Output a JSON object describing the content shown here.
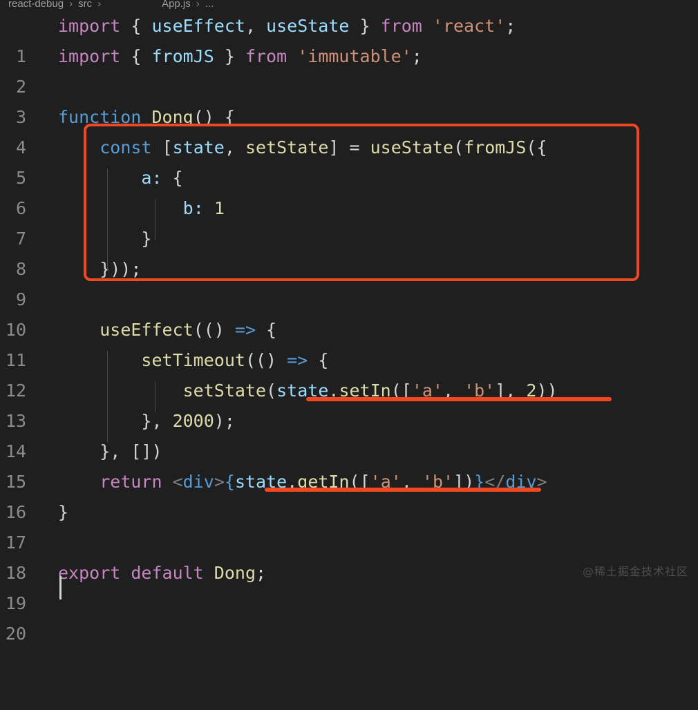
{
  "window": {
    "background_color": "#1f1f1f",
    "kind": "code-editor"
  },
  "breadcrumb": {
    "segments": [
      "react-debug",
      "src",
      "App.js",
      "..."
    ],
    "separator": "›",
    "full_text": "react-debug › src › App.js › ..."
  },
  "gutter": {
    "line_numbers": [
      "1",
      "2",
      "3",
      "4",
      "5",
      "6",
      "7",
      "8",
      "9",
      "10",
      "11",
      "12",
      "13",
      "14",
      "15",
      "16",
      "17",
      "18",
      "19",
      "20"
    ]
  },
  "editor": {
    "language": "javascript",
    "filename": "App.js",
    "lines": [
      {
        "n": "1",
        "text": "import { useEffect, useState } from 'react';"
      },
      {
        "n": "2",
        "text": "import { fromJS } from 'immutable';"
      },
      {
        "n": "3",
        "text": ""
      },
      {
        "n": "4",
        "text": "function Dong() {"
      },
      {
        "n": "5",
        "text": "    const [state, setState] = useState(fromJS({"
      },
      {
        "n": "6",
        "text": "        a: {"
      },
      {
        "n": "7",
        "text": "            b: 1"
      },
      {
        "n": "8",
        "text": "        }"
      },
      {
        "n": "9",
        "text": "    }));"
      },
      {
        "n": "10",
        "text": ""
      },
      {
        "n": "11",
        "text": "    useEffect(() => {"
      },
      {
        "n": "12",
        "text": "        setTimeout(() => {"
      },
      {
        "n": "13",
        "text": "            setState(state.setIn(['a', 'b'], 2))"
      },
      {
        "n": "14",
        "text": "        }, 2000);"
      },
      {
        "n": "15",
        "text": "    }, [])"
      },
      {
        "n": "16",
        "text": "    return <div>{state.getIn(['a', 'b'])}</div>"
      },
      {
        "n": "17",
        "text": "}"
      },
      {
        "n": "18",
        "text": ""
      },
      {
        "n": "19",
        "text": "export default Dong;"
      },
      {
        "n": "20",
        "text": ""
      }
    ]
  },
  "annotations": {
    "highlight_box": {
      "label": "red-rectangle-around-usestate-block",
      "covers_lines": [
        "5",
        "6",
        "7",
        "8",
        "9"
      ],
      "color": "#f24822"
    },
    "underlines": [
      {
        "label": "red-underline-setIn-call",
        "on_line": "13",
        "text": "state.setIn(['a', 'b'], 2)",
        "color": "#f24822"
      },
      {
        "label": "red-underline-getIn-call",
        "on_line": "16",
        "text": "state.getIn(['a', 'b'])",
        "color": "#f24822"
      }
    ]
  },
  "caret": {
    "on_line": "20",
    "column": "1"
  },
  "watermark": {
    "text": "@稀土掘金技术社区"
  },
  "theme": {
    "background": "#1f1f1f",
    "line_number": "#8b8b8b",
    "keyword": "#c586c0",
    "keyword_control": "#569cd6",
    "function": "#dcdcaa",
    "variable": "#9cdcfe",
    "string": "#ce9178",
    "number": "#b5cea8",
    "punctuation": "#d4d4d4",
    "annotation_red": "#f24822"
  }
}
